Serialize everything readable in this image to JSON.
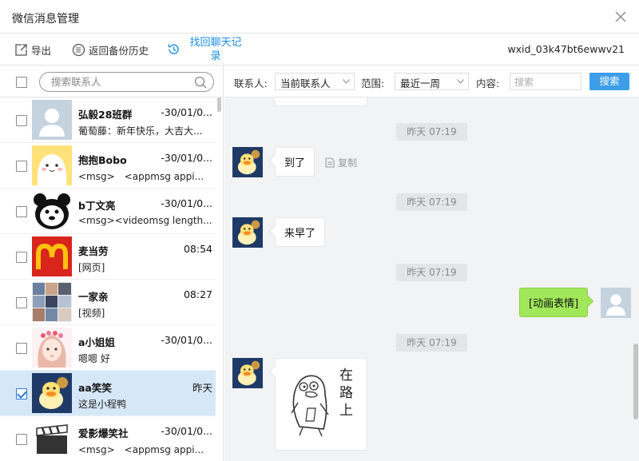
{
  "window": {
    "title": "微信消息管理"
  },
  "toolbar": {
    "export": "导出",
    "backup_history": "返回备份历史",
    "recover_line1": "找回聊天记",
    "recover_line2": "录",
    "wxid": "wxid_03k47bt6ewwv21"
  },
  "sidebar": {
    "search_placeholder": "搜索联系人",
    "contacts": [
      {
        "name": "弘毅28班群",
        "time": "-30/01/0...",
        "msg": "葡萄藤：新年快乐，大吉大...",
        "checked": false,
        "avatar": "default-avatar"
      },
      {
        "name": "抱抱Bobo",
        "time": "-30/01/0...",
        "msg": "<msg>　<appmsg appi...",
        "checked": false,
        "avatar": "bobo-avatar"
      },
      {
        "name": "b丁文亮",
        "time": "-30/01/0...",
        "msg": "<msg><videomsg length...",
        "checked": false,
        "avatar": "bear-avatar"
      },
      {
        "name": "麦当劳",
        "time": "08:54",
        "msg": "[网页]",
        "checked": false,
        "avatar": "mcdonalds-avatar"
      },
      {
        "name": "一家亲",
        "time": "08:27",
        "msg": "[视频]",
        "checked": false,
        "avatar": "group-photo-avatar"
      },
      {
        "name": "a小姐姐",
        "time": "-30/01/0...",
        "msg": "嗯嗯 好",
        "checked": false,
        "avatar": "girl-avatar"
      },
      {
        "name": "aa笑笑",
        "time": "昨天",
        "msg": "这是小程鸭",
        "checked": true,
        "avatar": "duck-avatar"
      },
      {
        "name": "爱影爆笑社",
        "time": "-30/01/0...",
        "msg": "<msg>　<appmsg appi...",
        "checked": false,
        "avatar": "clapper-avatar"
      }
    ]
  },
  "filter": {
    "contact_label": "联系人:",
    "contact_value": "当前联系人",
    "range_label": "范围:",
    "range_value": "最近一周",
    "content_label": "内容:",
    "content_placeholder": "搜索",
    "search_button": "搜索"
  },
  "chat": {
    "timestamps": [
      "昨天 07:19",
      "昨天 07:19",
      "昨天 07:19",
      "昨天 07:19"
    ],
    "messages": [
      {
        "text": "到了",
        "side": "left"
      },
      {
        "text": "来早了",
        "side": "left"
      },
      {
        "text": "[动画表情]",
        "side": "right"
      },
      {
        "text": "在路上",
        "side": "left",
        "type": "sticker"
      }
    ],
    "copy_label": "复制"
  },
  "colors": {
    "accent": "#3d9ee8",
    "selected_row": "#d6e8f8",
    "green_bubble": "#a0e759"
  }
}
